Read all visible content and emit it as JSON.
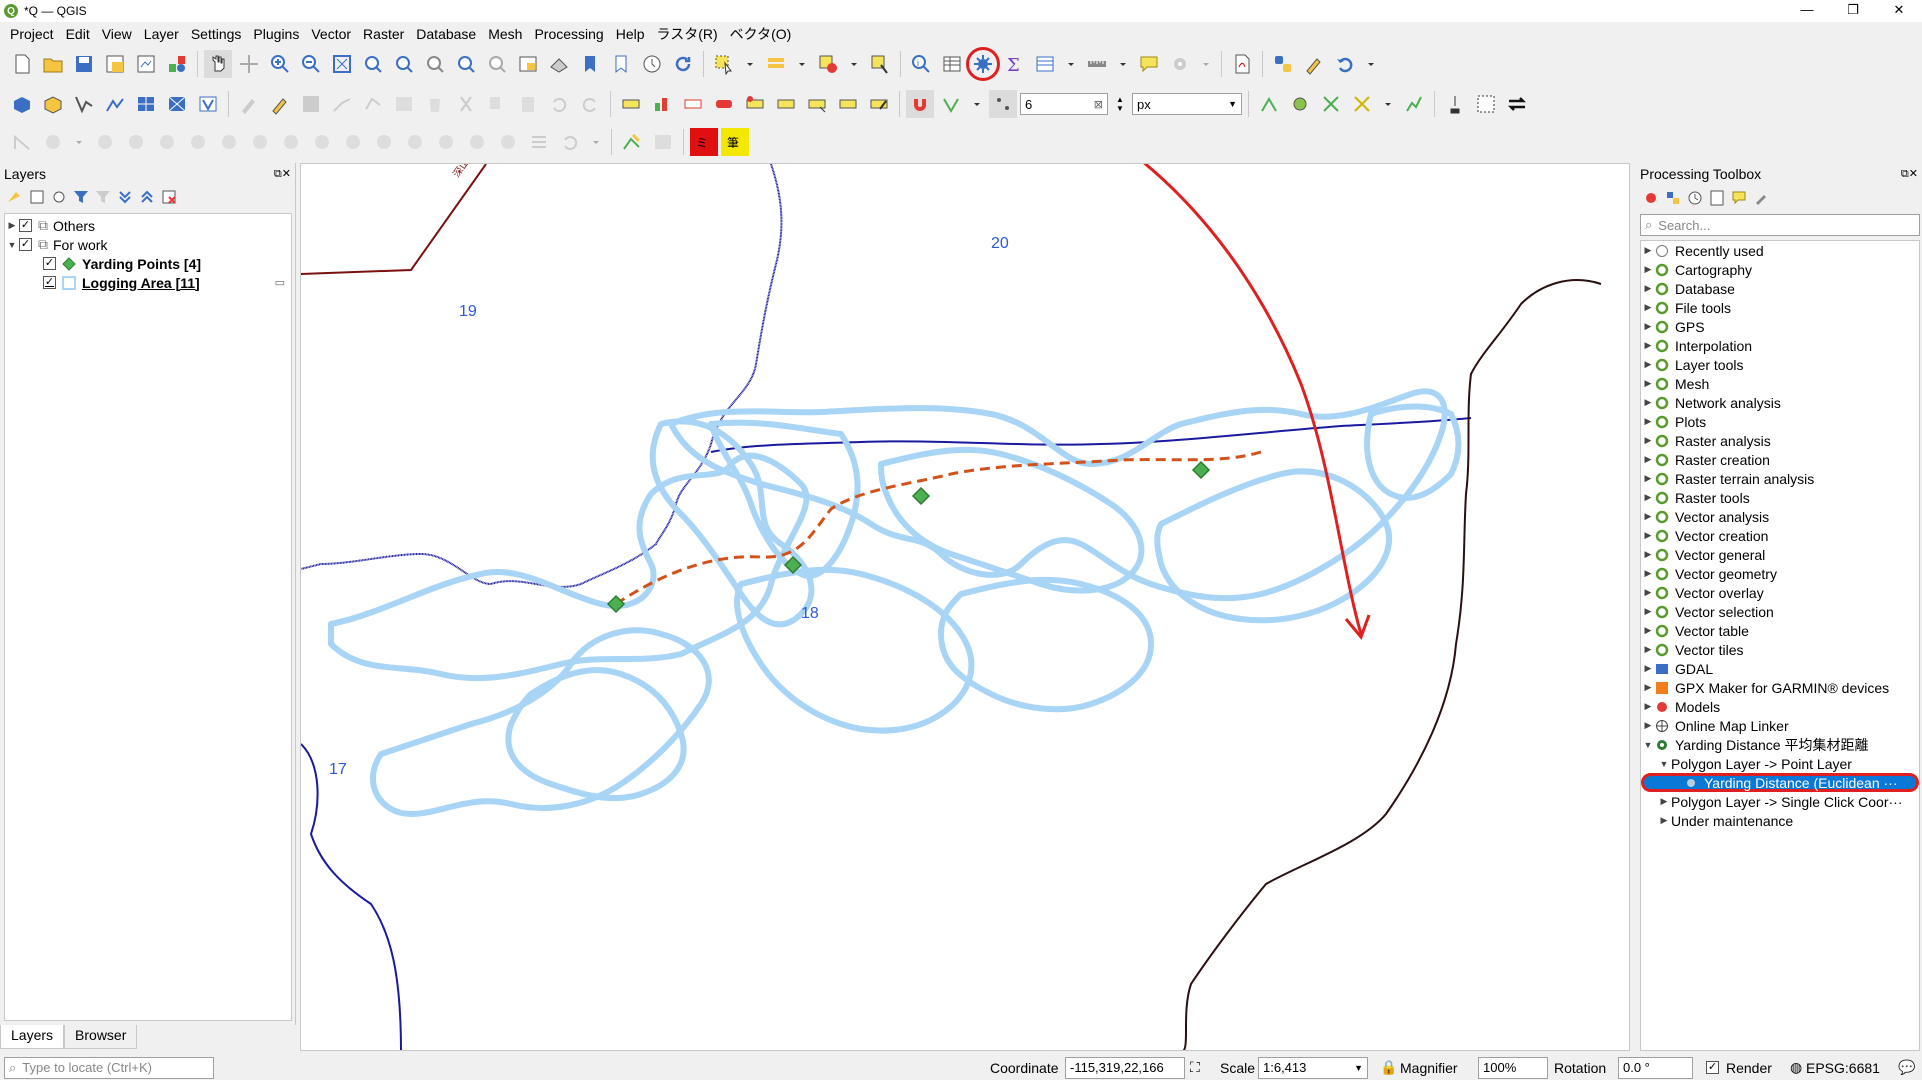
{
  "window": {
    "title": "*Q — QGIS",
    "minimize": "—",
    "maximize": "❐",
    "close": "✕"
  },
  "menu": [
    "Project",
    "Edit",
    "View",
    "Layer",
    "Settings",
    "Plugins",
    "Vector",
    "Raster",
    "Database",
    "Mesh",
    "Processing",
    "Help",
    "ラスタ(R)",
    "ベクタ(O)"
  ],
  "snapping": {
    "tolerance": "6",
    "unit": "px"
  },
  "layers_panel": {
    "title": "Layers",
    "groups": [
      {
        "label": "Others",
        "checked": true,
        "expanded": false
      },
      {
        "label": "For work",
        "checked": true,
        "expanded": true
      }
    ],
    "layers": [
      {
        "label": "Yarding Points [4]",
        "checked": true,
        "symbol": "green-diamond"
      },
      {
        "label": "Logging Area [11]",
        "checked": true,
        "symbol": "lightblue-polygon"
      }
    ]
  },
  "bottom_tabs": [
    "Layers",
    "Browser"
  ],
  "locate": {
    "placeholder": "Type to locate (Ctrl+K)"
  },
  "map": {
    "labels": [
      "20",
      "19",
      "18",
      "17",
      "深山"
    ],
    "colors": {
      "logging_area": "#a8d4f5",
      "yarding_points": "#4caf50",
      "route": "#d2521a",
      "boundary_blue": "#1a1aa0",
      "boundary_dark": "#2a1010",
      "annotation": "#e02020"
    }
  },
  "toolbox": {
    "title": "Processing Toolbox",
    "search_placeholder": "Search...",
    "providers": [
      "Recently used",
      "Cartography",
      "Database",
      "File tools",
      "GPS",
      "Interpolation",
      "Layer tools",
      "Mesh",
      "Network analysis",
      "Plots",
      "Raster analysis",
      "Raster creation",
      "Raster terrain analysis",
      "Raster tools",
      "Vector analysis",
      "Vector creation",
      "Vector general",
      "Vector geometry",
      "Vector overlay",
      "Vector selection",
      "Vector table",
      "Vector tiles",
      "GDAL",
      "GPX Maker for GARMIN® devices",
      "Models",
      "Online Map Linker",
      "Yarding Distance 平均集材距離"
    ],
    "sub_group": "Polygon Layer -> Point Layer",
    "selected_tool": "Yarding Distance (Euclidean ···",
    "other_group": "Polygon Layer -> Single Click Coor···",
    "maintenance": "Under maintenance"
  },
  "status": {
    "coordinate_label": "Coordinate",
    "coordinate": "-115,319,22,166",
    "scale_label": "Scale",
    "scale": "1:6,413",
    "magnifier_label": "Magnifier",
    "magnifier": "100%",
    "rotation_label": "Rotation",
    "rotation": "0.0 °",
    "render_label": "Render",
    "crs": "EPSG:6681"
  }
}
